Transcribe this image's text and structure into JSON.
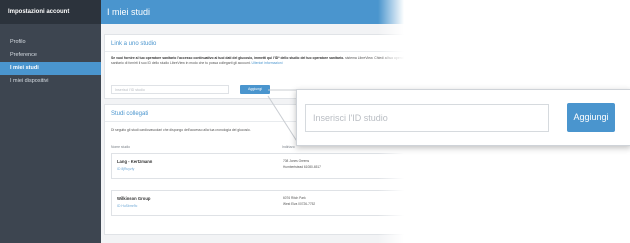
{
  "sidebar": {
    "title": "Impostazioni account",
    "items": [
      {
        "label": "Profilo"
      },
      {
        "label": "Preference"
      },
      {
        "label": "I miei studi"
      },
      {
        "label": "I miei dispositivi"
      }
    ]
  },
  "header": {
    "title": "I miei studi"
  },
  "link_section": {
    "title": "Link a uno studio",
    "description_bold": "Se vuoi fornire al tuo operatore sanitario l'accesso continuativo ai tuoi dati del glucosio, immetti qui l'ID* dello studio del tuo operatore sanitario.",
    "description": "sistema LibreView. Chiedi al tuo operatore sanitario di fornirti il suo ID dello studio LibreView in modo che tu possa collegarti gli account.",
    "description_link": "Ulteriori informazioni",
    "input_placeholder": "Inserisci l'ID studio",
    "add_button": "Aggiungi"
  },
  "linked_section": {
    "title": "Studi collegati",
    "description": "Di seguito gli studi cardiovascolari che dispongo dell'accesso alla tua cronologia del glucosio.",
    "columns": [
      "Nome studio",
      "Indirizzo"
    ],
    "rows": [
      {
        "name": "Lang - Kertzmann",
        "id": "ID 8jRuyzfy",
        "address1": "708 Jones Greens",
        "address2": "Humbertstead 61080-6517"
      },
      {
        "name": "Wilkinson Group",
        "id": "ID HuSbmr9c",
        "address1": "6076 Ritch Park",
        "address2": "West Elva 00726-7752"
      }
    ]
  },
  "zoom_callout": {
    "input_placeholder": "Inserisci l'ID studio",
    "add_button": "Aggiungi"
  },
  "colors": {
    "accent": "#4a95ce",
    "sidebar": "#3d4550",
    "sidebar_header": "#2c333c"
  }
}
